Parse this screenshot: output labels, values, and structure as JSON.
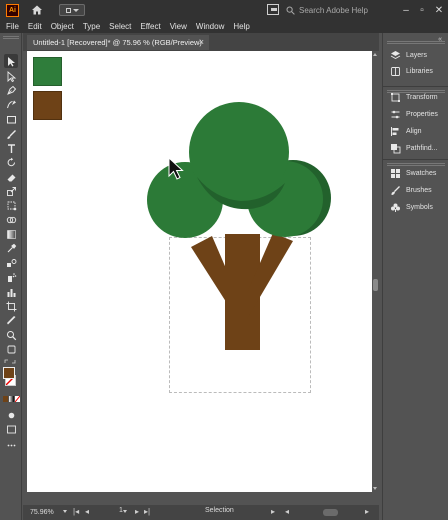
{
  "titlebar": {
    "app_logo": "Ai",
    "search_placeholder": "Search Adobe Help",
    "window_controls": [
      "minimize-icon",
      "maximize-icon",
      "close-icon"
    ]
  },
  "menu": [
    "File",
    "Edit",
    "Object",
    "Type",
    "Select",
    "Effect",
    "View",
    "Window",
    "Help"
  ],
  "document_tab": {
    "title": "Untitled-1 [Recovered]* @ 75.96 % (RGB/Preview)",
    "close": "×"
  },
  "tools": [
    "selection-tool-icon",
    "direct-selection-tool-icon",
    "pen-tool-icon",
    "curvature-tool-icon",
    "rectangle-tool-icon",
    "paintbrush-tool-icon",
    "type-tool-icon",
    "rotate-tool-icon",
    "eraser-tool-icon",
    "scale-tool-icon",
    "free-transform-tool-icon",
    "shape-builder-tool-icon",
    "gradient-tool-icon",
    "eyedropper-tool-icon",
    "blend-tool-icon",
    "symbol-sprayer-tool-icon",
    "column-graph-tool-icon",
    "artboard-tool-icon",
    "slice-tool-icon",
    "zoom-tool-icon",
    "hand-tool-icon",
    "swap-colors-icon"
  ],
  "panels": {
    "group1": [
      {
        "label": "Layers",
        "icon": "layers-icon"
      },
      {
        "label": "Libraries",
        "icon": "libraries-icon"
      }
    ],
    "group2": [
      {
        "label": "Transform",
        "icon": "transform-icon"
      },
      {
        "label": "Properties",
        "icon": "properties-icon"
      },
      {
        "label": "Align",
        "icon": "align-icon"
      },
      {
        "label": "Pathfind...",
        "icon": "pathfinder-icon"
      }
    ],
    "group3": [
      {
        "label": "Swatches",
        "icon": "swatches-icon"
      },
      {
        "label": "Brushes",
        "icon": "brushes-icon"
      },
      {
        "label": "Symbols",
        "icon": "symbols-icon"
      }
    ]
  },
  "statusbar": {
    "zoom": "75.96%",
    "artboard_number": "1",
    "status": "Selection"
  },
  "colors": {
    "leaf_green": "#2f7d3b",
    "leaf_dark_green": "#22612c",
    "trunk_brown": "#6e4217",
    "fill_swatch": "#6e4217",
    "stroke_swatch": "none"
  }
}
